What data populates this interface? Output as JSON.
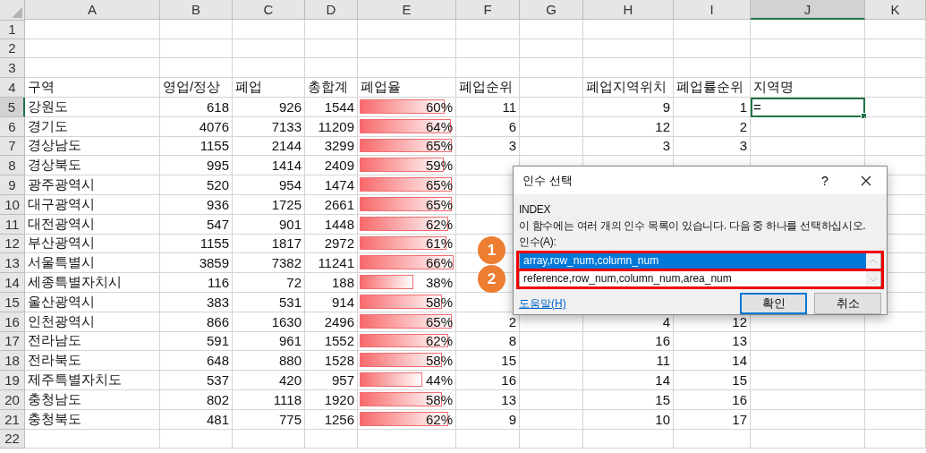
{
  "columns": [
    {
      "label": "A",
      "selected": false
    },
    {
      "label": "B",
      "selected": false
    },
    {
      "label": "C",
      "selected": false
    },
    {
      "label": "D",
      "selected": false
    },
    {
      "label": "E",
      "selected": false
    },
    {
      "label": "F",
      "selected": false
    },
    {
      "label": "G",
      "selected": false
    },
    {
      "label": "H",
      "selected": false
    },
    {
      "label": "I",
      "selected": false
    },
    {
      "label": "J",
      "selected": true
    },
    {
      "label": "K",
      "selected": false
    }
  ],
  "rows": [
    {
      "number": "1",
      "kind": "blank",
      "selected": false
    },
    {
      "number": "2",
      "kind": "blank",
      "selected": false
    },
    {
      "number": "3",
      "kind": "blank",
      "selected": false
    },
    {
      "number": "4",
      "kind": "header",
      "selected": false,
      "cells": [
        "구역",
        "영업/정상",
        "폐업",
        "총합계",
        "폐업율",
        "폐업순위",
        null,
        "폐업지역위치",
        "폐업률순위",
        "지역명",
        null
      ]
    },
    {
      "number": "5",
      "kind": "data",
      "selected": true,
      "cells": [
        "강원도",
        "618",
        "926",
        "1544",
        {
          "text": "60%",
          "level": 0.909
        },
        "11",
        null,
        "9",
        "1",
        "=",
        null
      ]
    },
    {
      "number": "6",
      "kind": "data",
      "selected": false,
      "cells": [
        "경기도",
        "4076",
        "7133",
        "11209",
        {
          "text": "64%",
          "level": 0.97
        },
        "6",
        null,
        "12",
        "2",
        null,
        null
      ]
    },
    {
      "number": "7",
      "kind": "data",
      "selected": false,
      "cells": [
        "경상남도",
        "1155",
        "2144",
        "3299",
        {
          "text": "65%",
          "level": 0.985
        },
        "3",
        null,
        "3",
        "3",
        null,
        null
      ]
    },
    {
      "number": "8",
      "kind": "data",
      "selected": false,
      "cells": [
        "경상북도",
        "995",
        "1414",
        "2409",
        {
          "text": "59%",
          "level": 0.894
        },
        null,
        null,
        null,
        null,
        null,
        null
      ]
    },
    {
      "number": "9",
      "kind": "data",
      "selected": false,
      "cells": [
        "광주광역시",
        "520",
        "954",
        "1474",
        {
          "text": "65%",
          "level": 0.985
        },
        null,
        null,
        null,
        null,
        null,
        null
      ]
    },
    {
      "number": "10",
      "kind": "data",
      "selected": false,
      "cells": [
        "대구광역시",
        "936",
        "1725",
        "2661",
        {
          "text": "65%",
          "level": 0.985
        },
        null,
        null,
        null,
        null,
        null,
        null
      ]
    },
    {
      "number": "11",
      "kind": "data",
      "selected": false,
      "cells": [
        "대전광역시",
        "547",
        "901",
        "1448",
        {
          "text": "62%",
          "level": 0.939
        },
        null,
        null,
        null,
        null,
        null,
        null
      ]
    },
    {
      "number": "12",
      "kind": "data",
      "selected": false,
      "cells": [
        "부산광역시",
        "1155",
        "1817",
        "2972",
        {
          "text": "61%",
          "level": 0.924
        },
        null,
        null,
        null,
        null,
        null,
        null
      ]
    },
    {
      "number": "13",
      "kind": "data",
      "selected": false,
      "cells": [
        "서울특별시",
        "3859",
        "7382",
        "11241",
        {
          "text": "66%",
          "level": 1
        },
        null,
        null,
        null,
        null,
        null,
        null
      ]
    },
    {
      "number": "14",
      "kind": "data",
      "selected": false,
      "cells": [
        "세종특별자치시",
        "116",
        "72",
        "188",
        {
          "text": "38%",
          "level": 0.576
        },
        null,
        null,
        null,
        null,
        null,
        null
      ]
    },
    {
      "number": "15",
      "kind": "data",
      "selected": false,
      "cells": [
        "울산광역시",
        "383",
        "531",
        "914",
        {
          "text": "58%",
          "level": 0.879
        },
        null,
        null,
        null,
        null,
        null,
        null
      ]
    },
    {
      "number": "16",
      "kind": "data",
      "selected": false,
      "cells": [
        "인천광역시",
        "866",
        "1630",
        "2496",
        {
          "text": "65%",
          "level": 0.985
        },
        "2",
        null,
        "4",
        "12",
        null,
        null
      ]
    },
    {
      "number": "17",
      "kind": "data",
      "selected": false,
      "cells": [
        "전라남도",
        "591",
        "961",
        "1552",
        {
          "text": "62%",
          "level": 0.939
        },
        "8",
        null,
        "16",
        "13",
        null,
        null
      ]
    },
    {
      "number": "18",
      "kind": "data",
      "selected": false,
      "cells": [
        "전라북도",
        "648",
        "880",
        "1528",
        {
          "text": "58%",
          "level": 0.879
        },
        "15",
        null,
        "11",
        "14",
        null,
        null
      ]
    },
    {
      "number": "19",
      "kind": "data",
      "selected": false,
      "cells": [
        "제주특별자치도",
        "537",
        "420",
        "957",
        {
          "text": "44%",
          "level": 0.667
        },
        "16",
        null,
        "14",
        "15",
        null,
        null
      ]
    },
    {
      "number": "20",
      "kind": "data",
      "selected": false,
      "cells": [
        "충청남도",
        "802",
        "1118",
        "1920",
        {
          "text": "58%",
          "level": 0.879
        },
        "13",
        null,
        "15",
        "16",
        null,
        null
      ]
    },
    {
      "number": "21",
      "kind": "data",
      "selected": false,
      "cells": [
        "충청북도",
        "481",
        "775",
        "1256",
        {
          "text": "62%",
          "level": 0.939
        },
        "9",
        null,
        "10",
        "17",
        null,
        null
      ]
    },
    {
      "number": "22",
      "kind": "blank",
      "selected": false
    }
  ],
  "dialog": {
    "title": "인수 선택",
    "help_button": "?",
    "function_name": "INDEX",
    "description": "이 함수에는 여러 개의 인수 목록이 있습니다. 다음 중 하나를 선택하십시오.",
    "list_label": "인수(A):",
    "options": [
      {
        "label": "array,row_num,column_num",
        "selected": true
      },
      {
        "label": "reference,row_num,column_num,area_num",
        "selected": false
      }
    ],
    "help_link": "도움말(H)",
    "buttons": [
      "확인",
      "취소"
    ]
  },
  "callouts": [
    "1",
    "2"
  ]
}
